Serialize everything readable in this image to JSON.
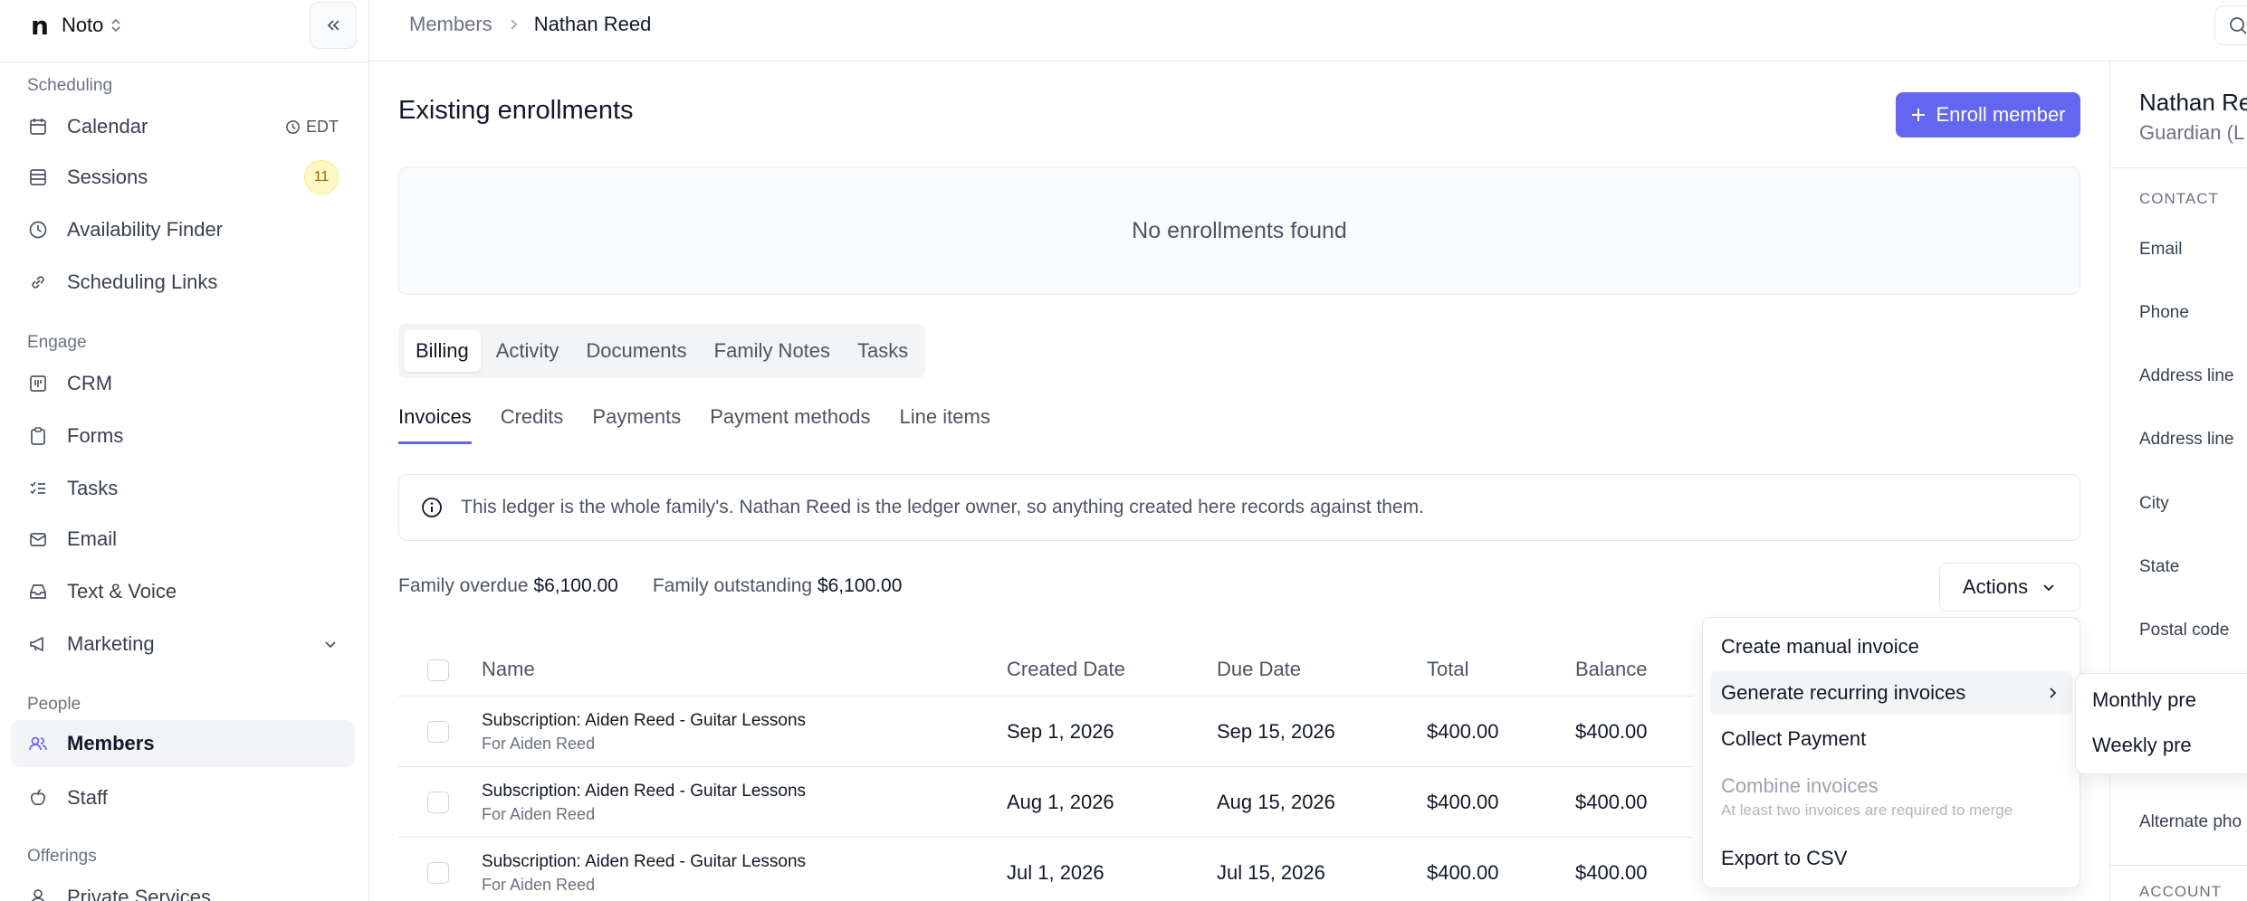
{
  "workspace": {
    "logo": "n",
    "name": "Noto"
  },
  "sidebar": {
    "sections": [
      {
        "label": "Scheduling"
      },
      {
        "label": "Engage"
      },
      {
        "label": "People"
      },
      {
        "label": "Offerings"
      }
    ],
    "items": [
      {
        "label": "Calendar",
        "icon": "calendar-icon",
        "extra": "EDT"
      },
      {
        "label": "Sessions",
        "icon": "list-icon",
        "badge": "11"
      },
      {
        "label": "Availability Finder",
        "icon": "clock-icon"
      },
      {
        "label": "Scheduling Links",
        "icon": "link-icon"
      },
      {
        "label": "CRM",
        "icon": "kanban-icon"
      },
      {
        "label": "Forms",
        "icon": "clipboard-icon"
      },
      {
        "label": "Tasks",
        "icon": "checklist-icon"
      },
      {
        "label": "Email",
        "icon": "mail-icon"
      },
      {
        "label": "Text & Voice",
        "icon": "inbox-icon"
      },
      {
        "label": "Marketing",
        "icon": "megaphone-icon"
      },
      {
        "label": "Members",
        "icon": "users-icon",
        "active": true
      },
      {
        "label": "Staff",
        "icon": "apple-icon"
      },
      {
        "label": "Private Services",
        "icon": "person-icon"
      }
    ]
  },
  "breadcrumb": {
    "parent": "Members",
    "current": "Nathan Reed"
  },
  "enrollments": {
    "title": "Existing enrollments",
    "enroll_label": "Enroll member",
    "empty": "No enrollments found"
  },
  "tabs": [
    "Billing",
    "Activity",
    "Documents",
    "Family Notes",
    "Tasks"
  ],
  "subtabs": [
    "Invoices",
    "Credits",
    "Payments",
    "Payment methods",
    "Line items"
  ],
  "info_text": "This ledger is the whole family's. Nathan Reed is the ledger owner, so anything created here records against them.",
  "summary": {
    "overdue_label": "Family overdue",
    "overdue_value": "$6,100.00",
    "outstanding_label": "Family outstanding",
    "outstanding_value": "$6,100.00"
  },
  "actions_label": "Actions",
  "table": {
    "headers": [
      "Name",
      "Created Date",
      "Due Date",
      "Total",
      "Balance"
    ],
    "rows": [
      {
        "name": "Subscription: Aiden Reed - Guitar Lessons",
        "for": "For Aiden Reed",
        "created": "Sep 1, 2026",
        "due": "Sep 15, 2026",
        "total": "$400.00",
        "balance": "$400.00"
      },
      {
        "name": "Subscription: Aiden Reed - Guitar Lessons",
        "for": "For Aiden Reed",
        "created": "Aug 1, 2026",
        "due": "Aug 15, 2026",
        "total": "$400.00",
        "balance": "$400.00"
      },
      {
        "name": "Subscription: Aiden Reed - Guitar Lessons",
        "for": "For Aiden Reed",
        "created": "Jul 1, 2026",
        "due": "Jul 15, 2026",
        "total": "$400.00",
        "balance": "$400.00"
      }
    ]
  },
  "menu": {
    "items": [
      "Create manual invoice",
      "Generate recurring invoices",
      "Collect Payment",
      "Combine invoices",
      "Export to CSV"
    ],
    "combine_hint": "At least two invoices are required to merge",
    "submenu": [
      "Monthly pre",
      "Weekly pre"
    ]
  },
  "profile": {
    "name": "Nathan Re",
    "role": "Guardian (L",
    "contact_label": "CONTACT",
    "fields": [
      "Email",
      "Phone",
      "Address line",
      "Address line",
      "City",
      "State",
      "Postal code",
      "Alternate pho"
    ],
    "account_label": "ACCOUNT"
  }
}
